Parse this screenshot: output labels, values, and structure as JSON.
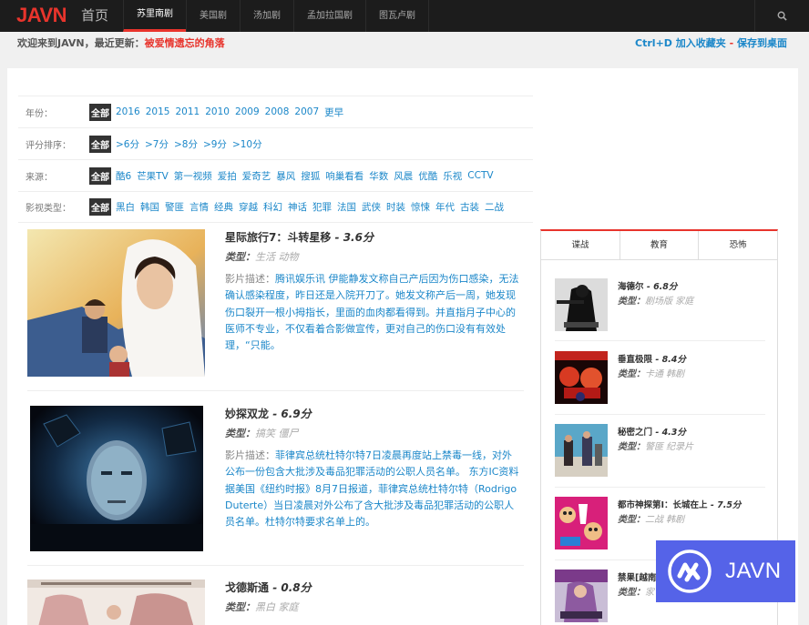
{
  "nav": {
    "logo": "JAVN",
    "home": "首页",
    "items": [
      "苏里南剧",
      "美国剧",
      "汤加剧",
      "孟加拉国剧",
      "图瓦卢剧"
    ],
    "search_icon": "search-icon"
  },
  "welcome": {
    "prefix": "欢迎来到JAVN，最近更新：",
    "latest": "被爱情遗忘的角落"
  },
  "bookmark": {
    "text1": "Ctrl+D 加入收藏夹",
    "dash": " - ",
    "text2": "保存到桌面"
  },
  "filters": [
    {
      "label": "年份：",
      "all": "全部",
      "options": [
        "2016",
        "2015",
        "2011",
        "2010",
        "2009",
        "2008",
        "2007",
        "更早"
      ]
    },
    {
      "label": "评分排序：",
      "all": "全部",
      "options": [
        ">6分",
        ">7分",
        ">8分",
        ">9分",
        ">10分"
      ]
    },
    {
      "label": "来源：",
      "all": "全部",
      "options": [
        "酷6",
        "芒果TV",
        "第一视频",
        "爱拍",
        "爱奇艺",
        "暴风",
        "搜狐",
        "响巢看看",
        "华数",
        "风晨",
        "优酷",
        "乐视",
        "CCTV"
      ]
    },
    {
      "label": "影视类型：",
      "all": "全部",
      "options": [
        "黑白",
        "韩国",
        "警匪",
        "言情",
        "经典",
        "穿越",
        "科幻",
        "神话",
        "犯罪",
        "法国",
        "武侠",
        "时装",
        "惊悚",
        "年代",
        "古装",
        "二战"
      ]
    }
  ],
  "movies": [
    {
      "title": "星际旅行7：斗转星移",
      "score": " - 3.6分",
      "type_label": "类型：",
      "type_value": "生活 动物",
      "desc_label": "影片描述：",
      "desc": "腾讯娱乐讯 伊能静发文称自己产后因为伤口感染，无法确认感染程度，昨日还是入院开刀了。她发文称产后一周，她发现伤口裂开一根小拇指长，里面的血肉都看得到。并直指月子中心的医师不专业，不仅看着合影做宣传，更对自己的伤口没有有效处理，“只能。"
    },
    {
      "title": "妙探双龙",
      "score": " - 6.9分",
      "type_label": "类型：",
      "type_value": "搞笑 僵尸",
      "desc_label": "影片描述：",
      "desc": "菲律宾总统杜特尔特7日凌晨再度站上禁毒一线，对外公布一份包含大批涉及毒品犯罪活动的公职人员名单。 东方IC资料据美国《纽约时报》8月7日报道，菲律宾总统杜特尔特（Rodrigo Duterte）当日凌晨对外公布了含大批涉及毒品犯罪活动的公职人员名单。杜特尔特要求名单上的。"
    },
    {
      "title": "戈德斯通",
      "score": " - 0.8分",
      "type_label": "类型：",
      "type_value": "黑白 家庭"
    }
  ],
  "sidebar": {
    "tabs": [
      "谍战",
      "教育",
      "恐怖"
    ],
    "items": [
      {
        "title": "海德尔",
        "score": " - 6.8分",
        "type_label": "类型：",
        "type_value": "剧场版 家庭"
      },
      {
        "title": "垂直极限",
        "score": " - 8.4分",
        "type_label": "类型：",
        "type_value": "卡通 韩剧"
      },
      {
        "title": "秘密之门",
        "score": " - 4.3分",
        "type_label": "类型：",
        "type_value": "警匪 纪录片"
      },
      {
        "title": "都市神探第I：长城在上",
        "score": " - 7.5分",
        "type_label": "类型：",
        "type_value": "二战 韩剧"
      },
      {
        "title": "禁果[越南]",
        "score": "",
        "type_label": "类型：",
        "type_value": "家"
      }
    ]
  },
  "watermark": {
    "text": "JAVN",
    "icon": "javn-logo-icon"
  },
  "colors": {
    "brand_red": "#e8342c",
    "link_blue": "#1b87c9",
    "topbar": "#1c1c1c",
    "watermark": "#5563e8"
  }
}
